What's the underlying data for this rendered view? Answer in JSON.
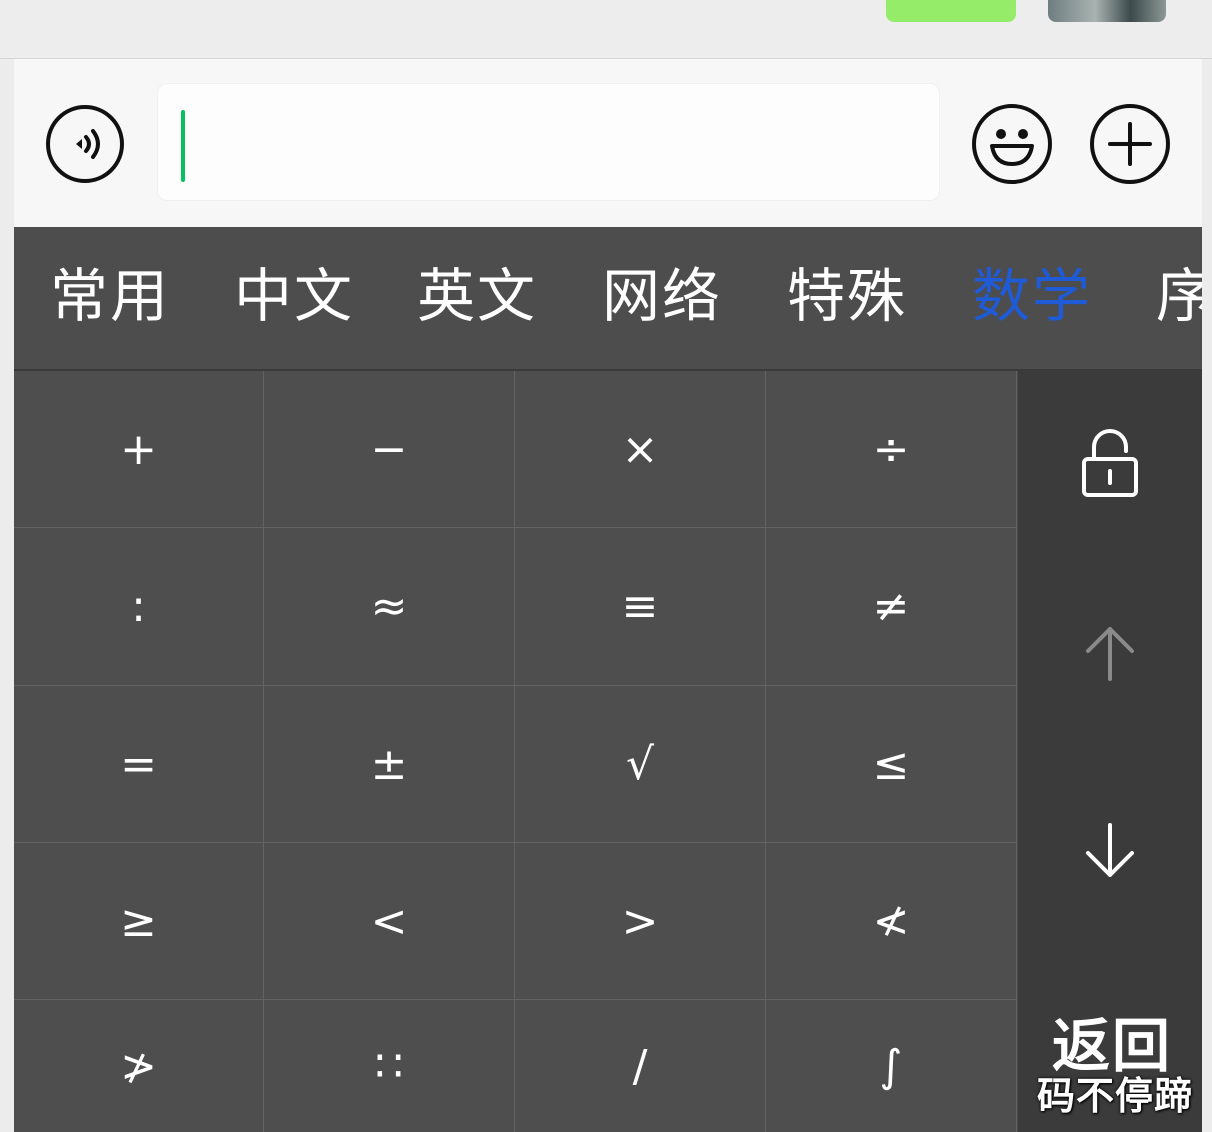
{
  "input": {
    "value": ""
  },
  "tabs": [
    {
      "label": "常用"
    },
    {
      "label": "中文"
    },
    {
      "label": "英文"
    },
    {
      "label": "网络"
    },
    {
      "label": "特殊"
    },
    {
      "label": "数学"
    },
    {
      "label": "序"
    }
  ],
  "active_tab": "数学",
  "colors": {
    "active_tab": "#1f5bd6",
    "caret": "#07c160",
    "keyboard_bg": "#4a4a4a"
  },
  "keys": [
    [
      "+",
      "−",
      "×",
      "÷"
    ],
    [
      ":",
      "≈",
      "≡",
      "≠"
    ],
    [
      "=",
      "±",
      "√",
      "≤"
    ],
    [
      "≥",
      "<",
      ">",
      "≮"
    ],
    [
      "≯",
      "∷",
      "/",
      "∫"
    ]
  ],
  "side": {
    "lock_icon": "unlock-icon",
    "up_icon": "arrow-up-icon",
    "down_icon": "arrow-down-icon",
    "back_label": "返回"
  },
  "watermark": "码不停蹄"
}
